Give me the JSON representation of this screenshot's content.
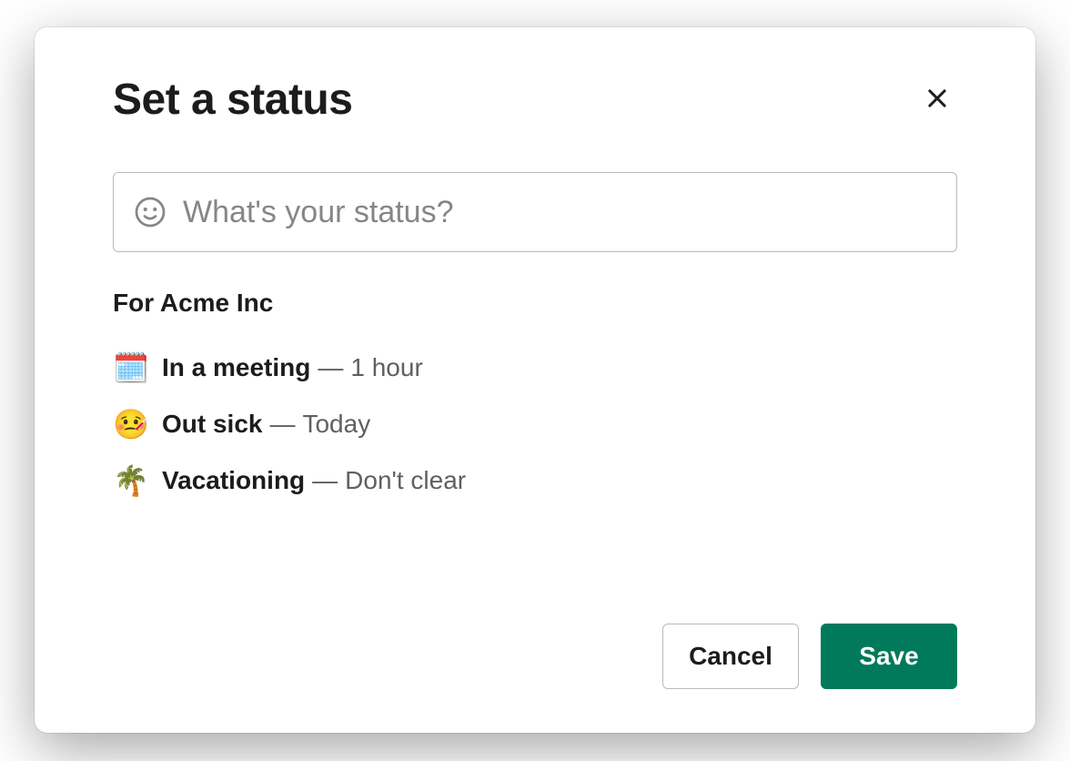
{
  "modal": {
    "title": "Set a status",
    "input": {
      "placeholder": "What's your status?",
      "value": ""
    },
    "org_label": "For Acme Inc",
    "presets": [
      {
        "emoji": "🗓️",
        "label": "In a meeting",
        "duration": "1 hour"
      },
      {
        "emoji": "🤒",
        "label": "Out sick",
        "duration": "Today"
      },
      {
        "emoji": "🌴",
        "label": "Vacationing",
        "duration": "Don't clear"
      }
    ],
    "separator": "—",
    "buttons": {
      "cancel": "Cancel",
      "save": "Save"
    }
  }
}
